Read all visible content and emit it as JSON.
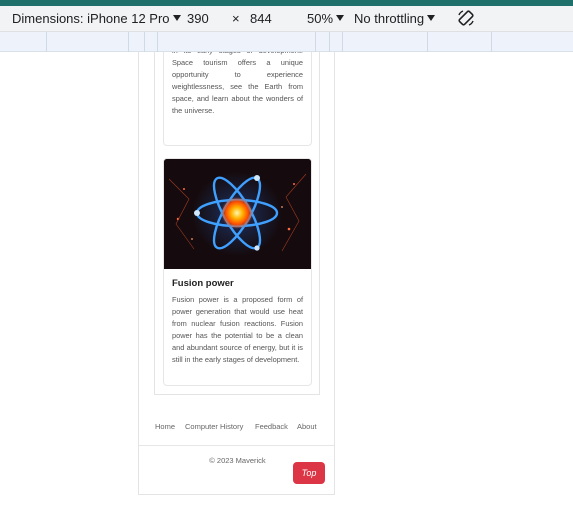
{
  "devtools": {
    "dimensions_label": "Dimensions: iPhone 12 Pro",
    "width_value": "390",
    "times_symbol": "×",
    "height_value": "844",
    "zoom": "50%",
    "throttling": "No throttling",
    "rotate_icon": "rotate-icon",
    "accent_color": "#1f6f6b"
  },
  "page": {
    "card1": {
      "text": "in its early stages of development. Space tourism offers a unique opportunity to experience weightlessness, see the Earth from space, and learn about the wonders of the universe."
    },
    "card2": {
      "image": "atom-energy-image",
      "title": "Fusion power",
      "text": "Fusion power is a proposed form of power generation that would use heat from nuclear fusion reactions. Fusion power has the potential to be a clean and abundant source of energy, but it is still in the early stages of development."
    },
    "footer": {
      "links": [
        "Home",
        "Computer History",
        "Feedback",
        "About"
      ],
      "copyright": "© 2023 Maverick",
      "top_button": "Top",
      "top_button_color": "#dc3545"
    }
  }
}
